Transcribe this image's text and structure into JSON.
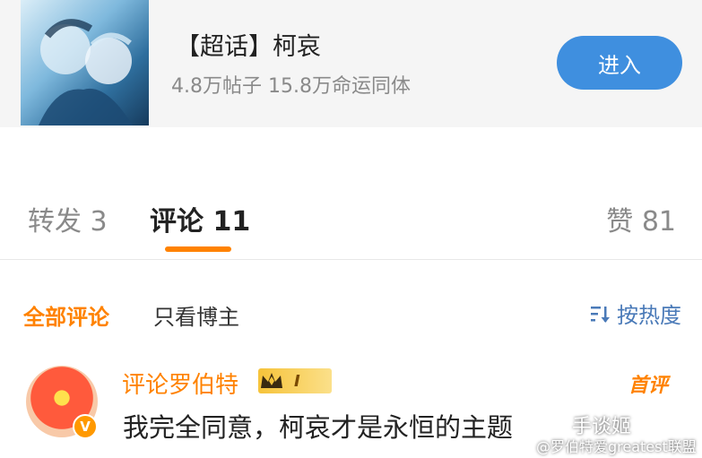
{
  "topic": {
    "title": "【超话】柯哀",
    "stats": "4.8万帖子 15.8万命运同体",
    "enter_label": "进入"
  },
  "tabs": {
    "repost": "转发 3",
    "comment": "评论 11",
    "like": "赞 81"
  },
  "filters": {
    "all": "全部评论",
    "owner_only": "只看博主",
    "sort": "按热度"
  },
  "comment": {
    "user": "评论罗伯特",
    "fan_level": "I",
    "first_badge": "首评",
    "verified_mark": "V",
    "text": "我完全同意，柯哀才是永恒的主题"
  },
  "watermark": {
    "line1": "手谈姬",
    "line2": "@罗伯特爱greatest联盟"
  },
  "colors": {
    "accent_orange": "#ff8200",
    "button_blue": "#3f8fdf",
    "sort_blue": "#4a7ab8"
  }
}
